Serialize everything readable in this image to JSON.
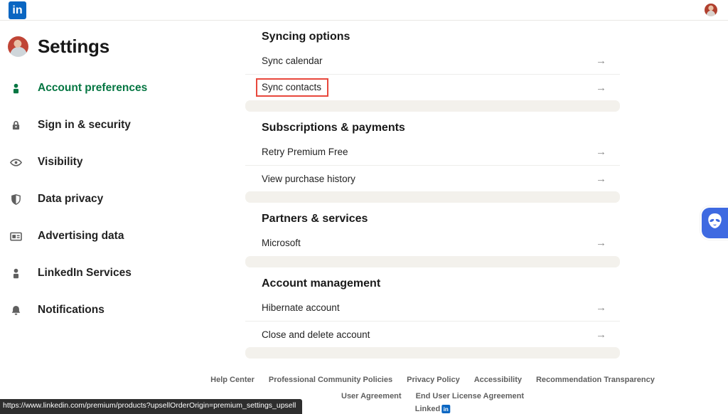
{
  "header": {
    "logo": "in"
  },
  "sidebar": {
    "title": "Settings",
    "items": [
      {
        "label": "Account preferences",
        "icon": "person-icon",
        "active": true
      },
      {
        "label": "Sign in & security",
        "icon": "lock-icon",
        "active": false
      },
      {
        "label": "Visibility",
        "icon": "eye-icon",
        "active": false
      },
      {
        "label": "Data privacy",
        "icon": "shield-icon",
        "active": false
      },
      {
        "label": "Advertising data",
        "icon": "ad-card-icon",
        "active": false
      },
      {
        "label": "LinkedIn Services",
        "icon": "person-icon",
        "active": false
      },
      {
        "label": "Notifications",
        "icon": "bell-icon",
        "active": false
      }
    ]
  },
  "main": {
    "arrow": "→",
    "sections": [
      {
        "title": "Syncing options",
        "rows": [
          {
            "label": "Sync calendar",
            "highlighted": false
          },
          {
            "label": "Sync contacts",
            "highlighted": true
          }
        ]
      },
      {
        "title": "Subscriptions & payments",
        "rows": [
          {
            "label": "Retry Premium Free",
            "highlighted": false
          },
          {
            "label": "View purchase history",
            "highlighted": false
          }
        ]
      },
      {
        "title": "Partners & services",
        "rows": [
          {
            "label": "Microsoft",
            "highlighted": false
          }
        ]
      },
      {
        "title": "Account management",
        "rows": [
          {
            "label": "Hibernate account",
            "highlighted": false
          },
          {
            "label": "Close and delete account",
            "highlighted": false
          }
        ]
      }
    ]
  },
  "footer": {
    "links_row1": [
      "Help Center",
      "Professional Community Policies",
      "Privacy Policy",
      "Accessibility",
      "Recommendation Transparency"
    ],
    "links_row2": [
      "User Agreement",
      "End User License Agreement"
    ],
    "logo_text": "Linked",
    "logo_badge": "in"
  },
  "statusbar": {
    "url": "https://www.linkedin.com/premium/products?upsellOrderOrigin=premium_settings_upsell"
  },
  "colors": {
    "accent_blue": "#0a66c2",
    "active_green": "#057642",
    "highlight_red": "#e8483c",
    "widget_blue": "#3e6ae1"
  }
}
